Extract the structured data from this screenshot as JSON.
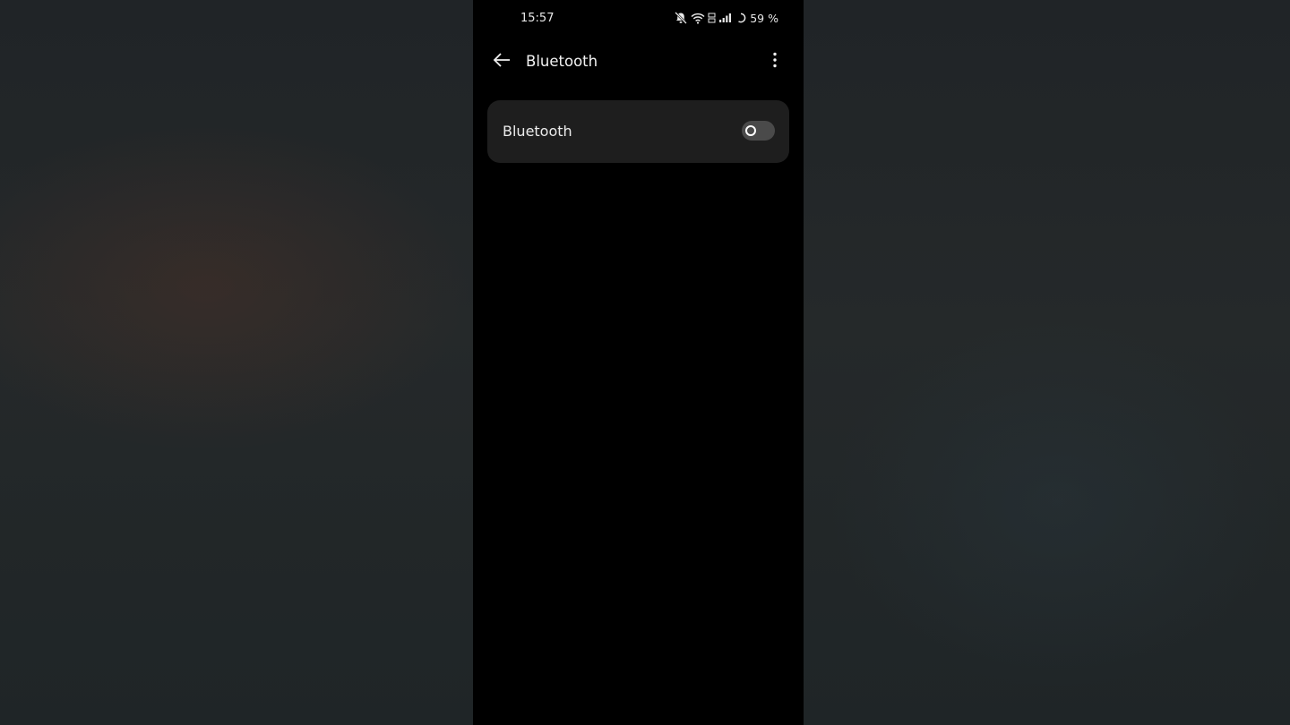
{
  "status_bar": {
    "time": "15:57",
    "icons": [
      "notifications-muted-icon",
      "wifi-icon",
      "network-type-icon",
      "cell-signal-icon",
      "battery-icon"
    ],
    "battery_percent": "59 %"
  },
  "app_bar": {
    "back_icon": "arrow-left-icon",
    "title": "Bluetooth",
    "menu_icon": "more-vert-icon"
  },
  "settings": {
    "bluetooth_label": "Bluetooth",
    "bluetooth_enabled": false
  },
  "colors": {
    "screen_bg": "#000000",
    "card_bg": "#1e1e1e",
    "toggle_off": "#4a4a4a",
    "text": "#ececec"
  }
}
